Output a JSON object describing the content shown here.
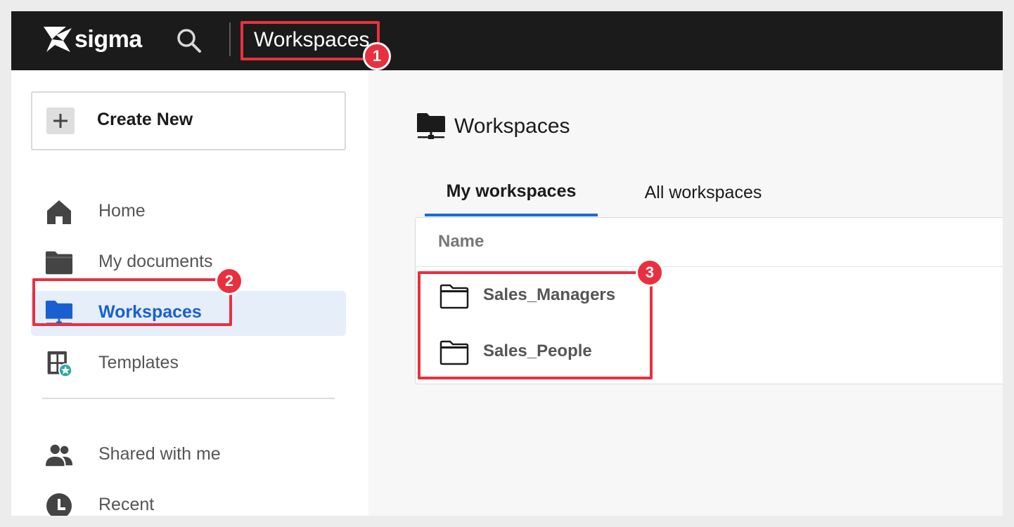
{
  "brand": {
    "name": "sigma"
  },
  "topbar": {
    "title": "Workspaces",
    "search_icon": "search-icon"
  },
  "sidebar": {
    "create_label": "Create New",
    "items": [
      {
        "label": "Home",
        "icon": "home-icon"
      },
      {
        "label": "My documents",
        "icon": "folder-icon"
      },
      {
        "label": "Workspaces",
        "icon": "workspace-icon",
        "active": true
      },
      {
        "label": "Templates",
        "icon": "templates-icon"
      },
      {
        "label": "Shared with me",
        "icon": "people-icon"
      },
      {
        "label": "Recent",
        "icon": "clock-icon"
      }
    ]
  },
  "main": {
    "heading": "Workspaces",
    "tabs": [
      {
        "label": "My workspaces",
        "active": true
      },
      {
        "label": "All workspaces",
        "active": false
      }
    ],
    "table": {
      "columns": [
        "Name"
      ],
      "rows": [
        {
          "name": "Sales_Managers"
        },
        {
          "name": "Sales_People"
        }
      ]
    }
  },
  "callouts": [
    "1",
    "2",
    "3"
  ],
  "colors": {
    "accent": "#1a6bdc",
    "callout": "#e8303f",
    "topbar": "#1b1b1b"
  }
}
